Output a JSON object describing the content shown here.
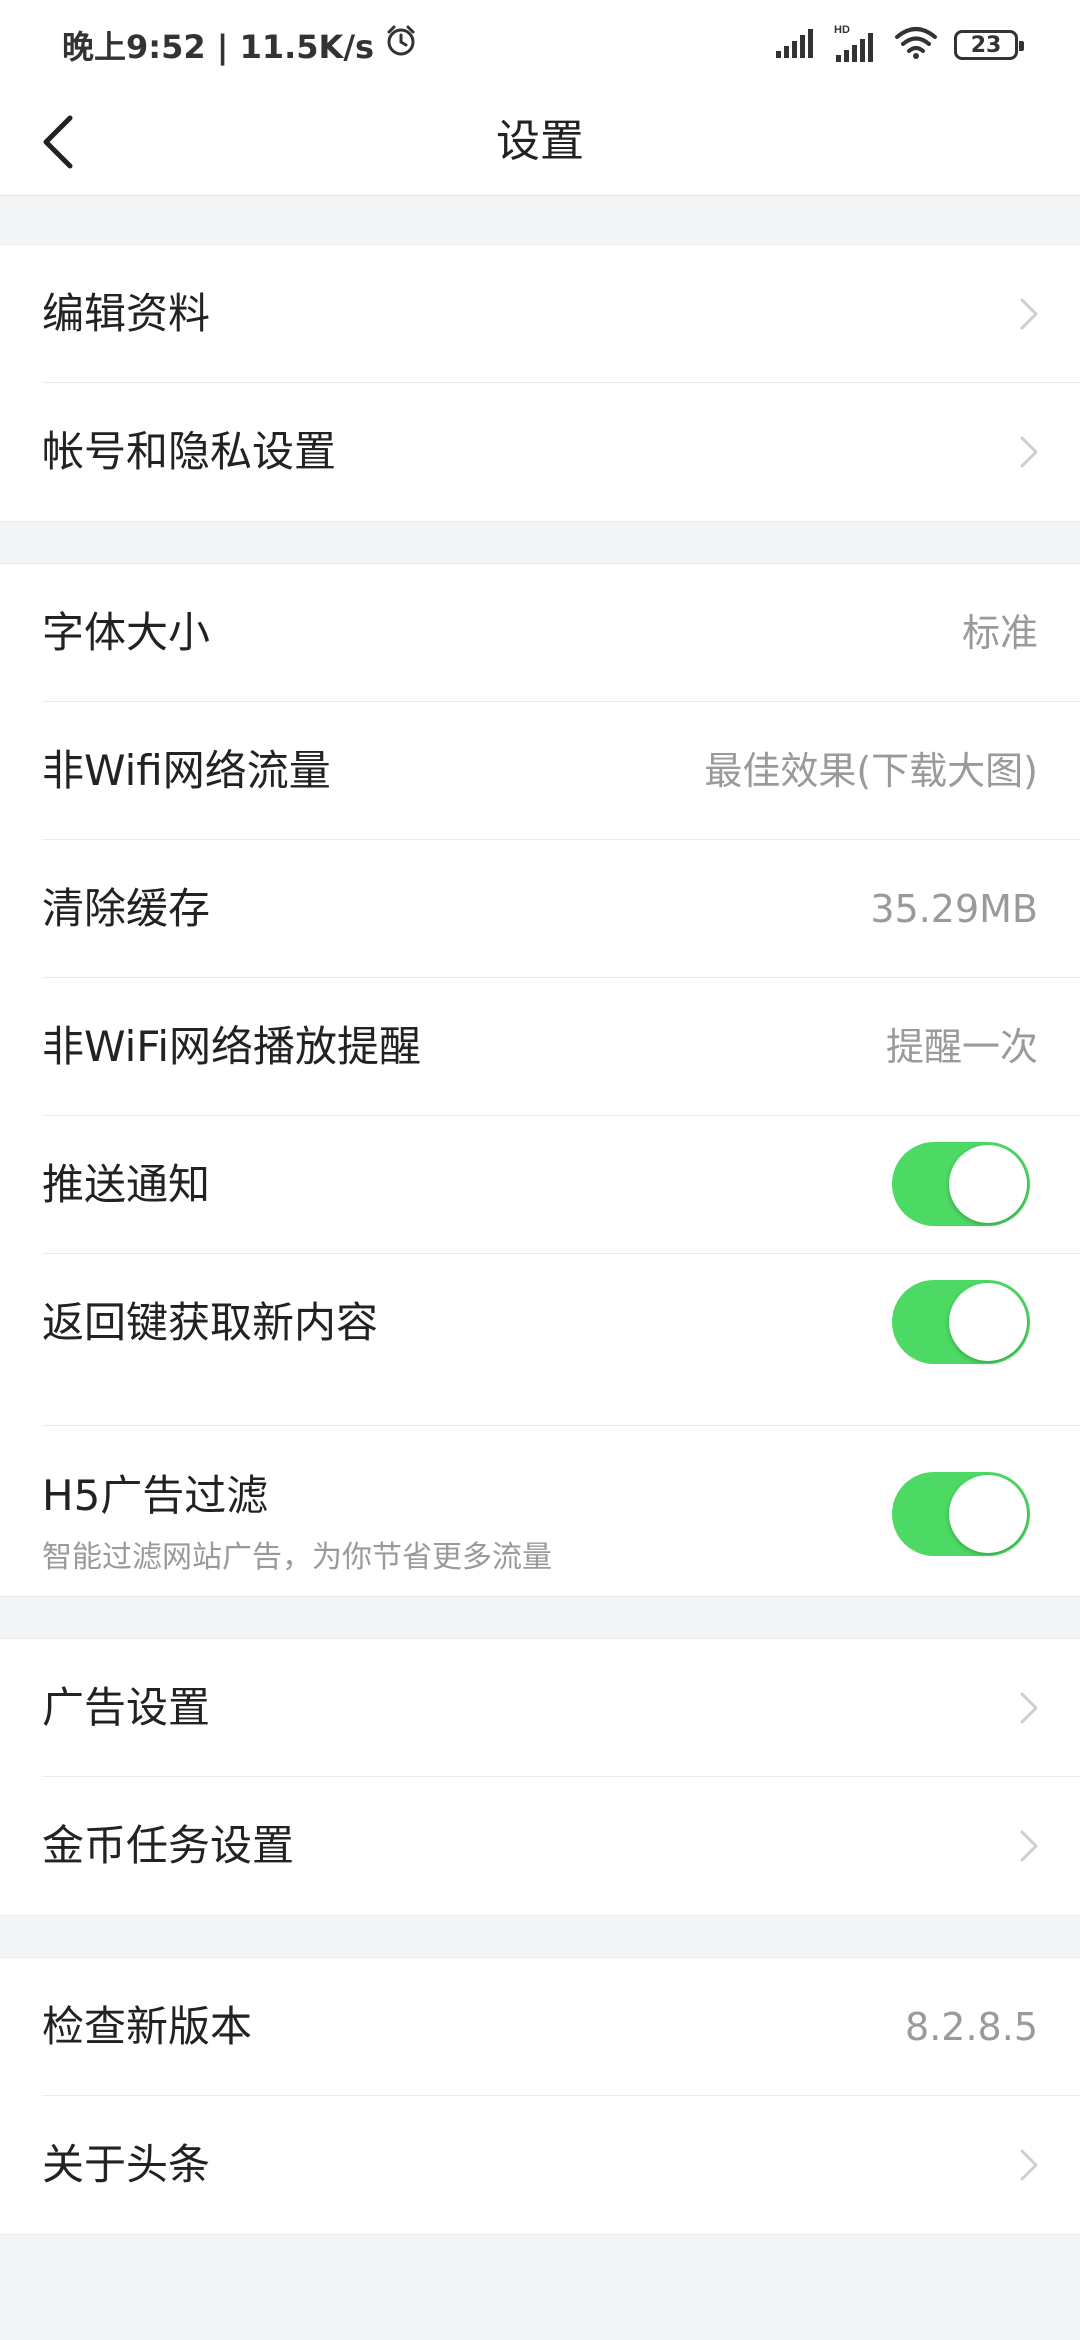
{
  "status_bar": {
    "time": "晚上9:52 | 11.5K/s",
    "battery": "23",
    "icons": [
      "alarm-icon",
      "signal-icon",
      "hd-signal-icon",
      "wifi-icon",
      "battery-icon"
    ]
  },
  "header": {
    "title": "设置",
    "back_icon": "chevron-left-icon"
  },
  "groups": [
    {
      "items": [
        {
          "label": "编辑资料",
          "type": "arrow"
        },
        {
          "label": "帐号和隐私设置",
          "type": "arrow"
        }
      ]
    },
    {
      "items": [
        {
          "label": "字体大小",
          "value": "标准",
          "type": "value"
        },
        {
          "label": "非Wifi网络流量",
          "value": "最佳效果(下载大图)",
          "type": "value"
        },
        {
          "label": "清除缓存",
          "value": "35.29MB",
          "type": "value"
        },
        {
          "label": "非WiFi网络播放提醒",
          "value": "提醒一次",
          "type": "value"
        },
        {
          "label": "推送通知",
          "type": "toggle",
          "on": true
        },
        {
          "label": "返回键获取新内容",
          "type": "toggle",
          "on": true
        },
        {
          "label": "H5广告过滤",
          "sub": "智能过滤网站广告，为你节省更多流量",
          "type": "toggle",
          "on": true
        }
      ]
    },
    {
      "items": [
        {
          "label": "广告设置",
          "type": "arrow"
        },
        {
          "label": "金币任务设置",
          "type": "arrow"
        }
      ]
    },
    {
      "items": [
        {
          "label": "检查新版本",
          "value": "8.2.8.5",
          "type": "value"
        },
        {
          "label": "关于头条",
          "type": "arrow"
        }
      ]
    }
  ],
  "colors": {
    "toggle_on": "#4cd964",
    "background": "#f4f5f6",
    "value_text": "#9a9a9a"
  }
}
